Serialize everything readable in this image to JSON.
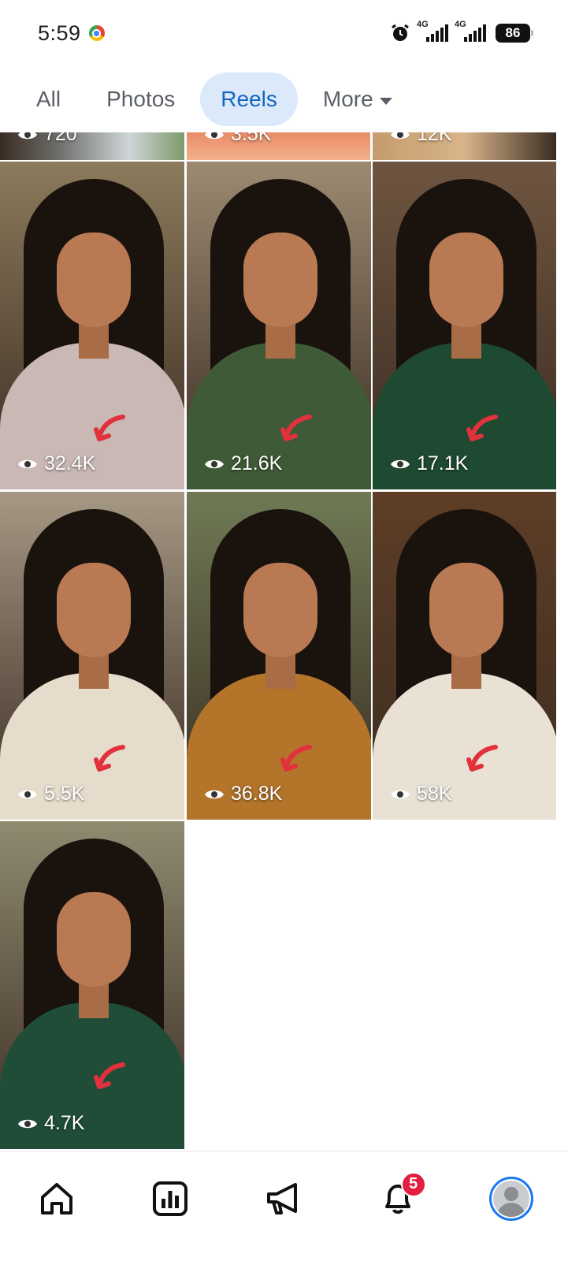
{
  "status_bar": {
    "time": "5:59",
    "network_1": "4G",
    "network_2": "4G",
    "battery": "86"
  },
  "tabs": [
    {
      "label": "All",
      "active": false
    },
    {
      "label": "Photos",
      "active": false
    },
    {
      "label": "Reels",
      "active": true
    },
    {
      "label": "More",
      "active": false
    }
  ],
  "partial_row": [
    {
      "views": "720"
    },
    {
      "views": "3.5K"
    },
    {
      "views": "12K"
    }
  ],
  "reels": [
    {
      "views": "32.4K",
      "outfit_color": "#c9b8b4",
      "bg_color": "#8c7a5c"
    },
    {
      "views": "21.6K",
      "outfit_color": "#3f5a36",
      "bg_color": "#9c8a72"
    },
    {
      "views": "17.1K",
      "outfit_color": "#1d4a30",
      "bg_color": "#6e5540"
    },
    {
      "views": "5.5K",
      "outfit_color": "#e6dccb",
      "bg_color": "#a59884"
    },
    {
      "views": "36.8K",
      "outfit_color": "#b4742a",
      "bg_color": "#6f7a55"
    },
    {
      "views": "58K",
      "outfit_color": "#e8e1d4",
      "bg_color": "#5e3e26"
    },
    {
      "views": "4.7K",
      "outfit_color": "#1f4d38",
      "bg_color": "#8f8a70"
    }
  ],
  "bottom_nav": {
    "home": "home-icon",
    "insights": "bar-chart-icon",
    "ads": "megaphone-icon",
    "notifications": "bell-icon",
    "notification_count": "5",
    "profile": "profile-avatar"
  },
  "colors": {
    "accent": "#1877f2",
    "tab_active_bg": "#dbe9fb",
    "tab_active_text": "#1565c0",
    "badge": "#e41e3f",
    "arrow": "#e0313c"
  }
}
